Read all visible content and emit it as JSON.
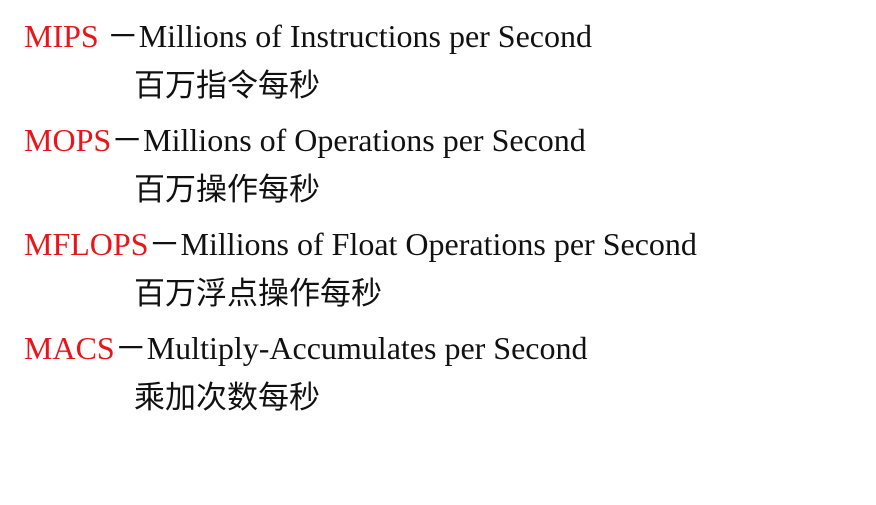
{
  "entries": [
    {
      "abbr": "MIPS",
      "separator": " －",
      "description": "Millions of Instructions per Second",
      "chinese": "百万指令每秒"
    },
    {
      "abbr": "MOPS",
      "separator": "－",
      "description": "Millions of Operations per Second",
      "chinese": "百万操作每秒"
    },
    {
      "abbr": "MFLOPS",
      "separator": "－",
      "description": "Millions of Float Operations per Second",
      "chinese": "百万浮点操作每秒"
    },
    {
      "abbr": "MACS",
      "separator": "－",
      "description": "Multiply-Accumulates per Second",
      "chinese": "乘加次数每秒"
    }
  ],
  "colors": {
    "abbreviation": "#e8161b",
    "text": "#111111",
    "background": "#ffffff"
  }
}
